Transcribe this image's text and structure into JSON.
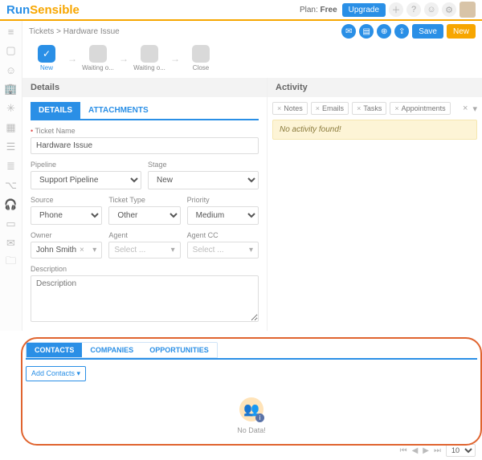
{
  "brand": {
    "part1": "Run",
    "part2": "Sensible"
  },
  "plan": {
    "label": "Plan:",
    "value": "Free",
    "upgrade": "Upgrade"
  },
  "header_buttons": {
    "save": "Save",
    "new": "New"
  },
  "breadcrumbs": {
    "root": "Tickets",
    "sep": ">",
    "current": "Hardware Issue"
  },
  "stages": [
    {
      "label": "New",
      "active": true,
      "check": "✓"
    },
    {
      "label": "Waiting o...",
      "active": false
    },
    {
      "label": "Waiting o...",
      "active": false
    },
    {
      "label": "Close",
      "active": false
    }
  ],
  "panels": {
    "details": "Details",
    "activity": "Activity"
  },
  "detail_tabs": {
    "details": "DETAILS",
    "attachments": "ATTACHMENTS"
  },
  "form": {
    "ticket_name_label": "Ticket Name",
    "ticket_name_value": "Hardware Issue",
    "pipeline_label": "Pipeline",
    "pipeline_value": "Support Pipeline",
    "stage_label": "Stage",
    "stage_value": "New",
    "source_label": "Source",
    "source_value": "Phone",
    "ticket_type_label": "Ticket Type",
    "ticket_type_value": "Other",
    "priority_label": "Priority",
    "priority_value": "Medium",
    "owner_label": "Owner",
    "owner_value": "John Smith",
    "agent_label": "Agent",
    "agent_placeholder": "Select ...",
    "agent_cc_label": "Agent CC",
    "agent_cc_placeholder": "Select ...",
    "description_label": "Description",
    "description_placeholder": "Description"
  },
  "activity": {
    "filters": [
      "Notes",
      "Emails",
      "Tasks",
      "Appointments"
    ],
    "empty": "No activity found!"
  },
  "bottom": {
    "tabs": {
      "contacts": "CONTACTS",
      "companies": "COMPANIES",
      "opportunities": "OPPORTUNITIES"
    },
    "add_contacts": "Add Contacts",
    "no_data": "No Data!"
  },
  "pager": {
    "size": "10"
  }
}
